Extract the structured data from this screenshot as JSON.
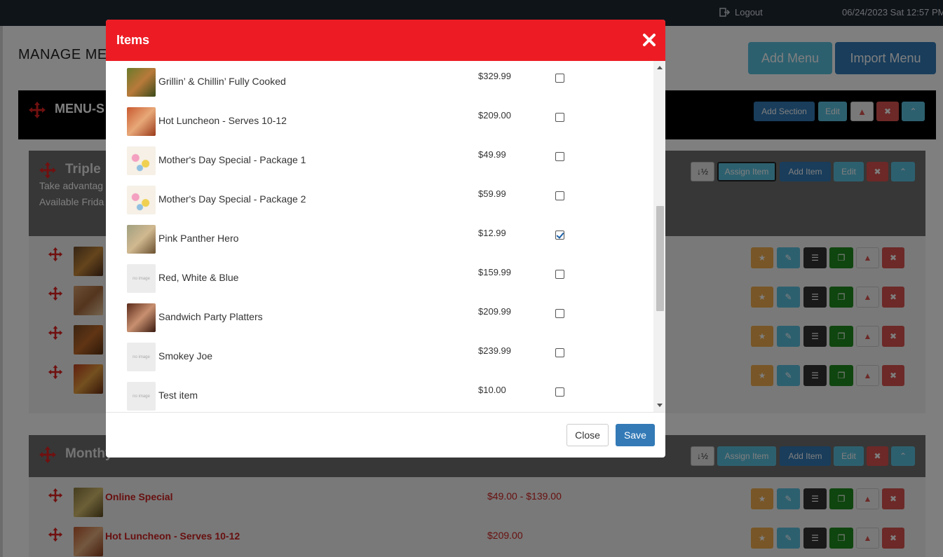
{
  "topbar": {
    "logout_label": "Logout",
    "datetime": "06/24/2023 Sat 12:57 PM"
  },
  "page": {
    "title": "MANAGE MENU",
    "add_menu_label": "Add Menu",
    "import_menu_label": "Import Menu",
    "menu_name": "MENU-S",
    "add_section_label": "Add Section",
    "edit_label": "Edit"
  },
  "sections": [
    {
      "title": "Triple",
      "desc1": "Take advantag",
      "desc2": "Available Frida",
      "sort_label": "↓½",
      "assign_label": "Assign Item",
      "add_item_label": "Add Item",
      "edit_label": "Edit"
    },
    {
      "title": "Monthy",
      "sort_label": "↓½",
      "assign_label": "Assign Item",
      "add_item_label": "Add Item",
      "edit_label": "Edit",
      "items": [
        {
          "name": "Online Special",
          "price": "$49.00 - $139.00"
        },
        {
          "name": "Hot Luncheon - Serves 10-12",
          "price": "$209.00"
        }
      ]
    }
  ],
  "modal": {
    "title": "Items",
    "close_label": "Close",
    "save_label": "Save",
    "items": [
      {
        "name": "Grillin’ & Chillin’ Fully Cooked",
        "price": "$329.99",
        "checked": false,
        "image": "photo"
      },
      {
        "name": "Hot Luncheon - Serves 10-12",
        "price": "$209.00",
        "checked": false,
        "image": "photo"
      },
      {
        "name": "Mother's Day Special - Package 1",
        "price": "$49.99",
        "checked": false,
        "image": "flowers"
      },
      {
        "name": "Mother's Day Special - Package 2",
        "price": "$59.99",
        "checked": false,
        "image": "flowers"
      },
      {
        "name": "Pink Panther Hero",
        "price": "$12.99",
        "checked": true,
        "image": "photo"
      },
      {
        "name": "Red, White & Blue",
        "price": "$159.99",
        "checked": false,
        "image": "none"
      },
      {
        "name": "Sandwich Party Platters",
        "price": "$209.99",
        "checked": false,
        "image": "photo"
      },
      {
        "name": "Smokey Joe",
        "price": "$239.99",
        "checked": false,
        "image": "none"
      },
      {
        "name": "Test item",
        "price": "$10.00",
        "checked": false,
        "image": "none"
      }
    ],
    "no_image_text": "no image"
  },
  "colors": {
    "modal_header": "#ed1c24",
    "primary": "#337ab7",
    "info": "#5bc0de",
    "danger": "#d9534f",
    "warning": "#f0ad4e"
  }
}
